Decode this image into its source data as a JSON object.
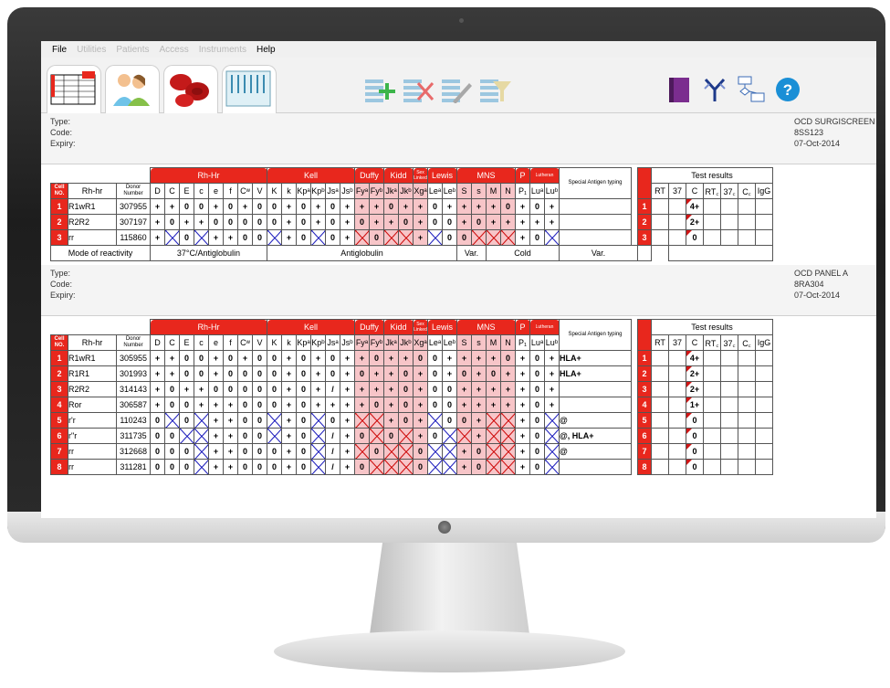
{
  "menu": {
    "file": "File",
    "utilities": "Utilities",
    "patients": "Patients",
    "access": "Access",
    "instruments": "Instruments",
    "help": "Help"
  },
  "icons": {
    "tab1": "panel-grid-icon",
    "tab2": "patients-icon",
    "tab3": "blood-cells-icon",
    "tab4": "cassette-icon",
    "add": "add-row-icon",
    "delete": "delete-row-icon",
    "edit": "edit-icon",
    "filter": "filter-icon",
    "book": "book-icon",
    "antibody": "antibody-icon",
    "workflow": "workflow-icon",
    "help": "help-icon"
  },
  "sections": [
    {
      "info": {
        "type_label": "Type:",
        "code_label": "Code:",
        "expiry_label": "Expiry:",
        "type": "OCD SURGISCREEN",
        "code": "8SS123",
        "expiry": "07-Oct-2014"
      },
      "rows": [
        {
          "no": "1",
          "rh": "R1wR1",
          "donor": "307955",
          "special": "",
          "res": [
            "",
            "",
            "4+",
            "",
            "",
            ""
          ]
        },
        {
          "no": "2",
          "rh": "R2R2",
          "donor": "307197",
          "special": "",
          "res": [
            "",
            "",
            "2+",
            "",
            "",
            ""
          ]
        },
        {
          "no": "3",
          "rh": "rr",
          "donor": "115860",
          "special": "",
          "res": [
            "",
            "",
            "0",
            "",
            "",
            ""
          ]
        }
      ],
      "mode": {
        "label": "Mode of reactivity",
        "rh": "37°C/Antiglobulin",
        "kell": "Antiglobulin",
        "lewis": "Var.",
        "mns": "Cold",
        "luth": "Var."
      }
    },
    {
      "info": {
        "type_label": "Type:",
        "code_label": "Code:",
        "expiry_label": "Expiry:",
        "type": "OCD PANEL A",
        "code": "8RA304",
        "expiry": "07-Oct-2014"
      },
      "rows": [
        {
          "no": "1",
          "rh": "R1wR1",
          "donor": "305955",
          "special": "HLA+",
          "res": [
            "",
            "",
            "4+",
            "",
            "",
            ""
          ]
        },
        {
          "no": "2",
          "rh": "R1R1",
          "donor": "301993",
          "special": "HLA+",
          "res": [
            "",
            "",
            "2+",
            "",
            "",
            ""
          ]
        },
        {
          "no": "3",
          "rh": "R2R2",
          "donor": "314143",
          "special": "",
          "res": [
            "",
            "",
            "2+",
            "",
            "",
            ""
          ]
        },
        {
          "no": "4",
          "rh": "Ror",
          "donor": "306587",
          "special": "",
          "res": [
            "",
            "",
            "1+",
            "",
            "",
            ""
          ]
        },
        {
          "no": "5",
          "rh": "r'r",
          "donor": "110243",
          "special": "@",
          "res": [
            "",
            "",
            "0",
            "",
            "",
            ""
          ]
        },
        {
          "no": "6",
          "rh": "r\"r",
          "donor": "311735",
          "special": "@, HLA+",
          "res": [
            "",
            "",
            "0",
            "",
            "",
            ""
          ]
        },
        {
          "no": "7",
          "rh": "rr",
          "donor": "312668",
          "special": "@",
          "res": [
            "",
            "",
            "0",
            "",
            "",
            ""
          ]
        },
        {
          "no": "8",
          "rh": "rr",
          "donor": "311281",
          "special": "",
          "res": [
            "",
            "",
            "0",
            "",
            "",
            ""
          ]
        }
      ]
    }
  ],
  "headers": {
    "cell_no": "Cell NO.",
    "rh_hr": "Rh-hr",
    "donor": "Donor Number",
    "groups": {
      "rh": "Rh-Hr",
      "kell": "Kell",
      "duffy": "Duffy",
      "kidd": "Kidd",
      "sex": "Sex Linked",
      "lewis": "Lewis",
      "mns": "MNS",
      "p": "P",
      "luth": "Lutheran"
    },
    "special": "Special Antigen typing",
    "test": "Test results",
    "ant": [
      "D",
      "C",
      "E",
      "c",
      "e",
      "f",
      "Cʷ",
      "V",
      "K",
      "k",
      "Kpᵃ",
      "Kpᵇ",
      "Jsᵃ",
      "Jsᵇ",
      "Fyᵃ",
      "Fyᵇ",
      "Jkᵃ",
      "Jkᵇ",
      "Xgᵃ",
      "Leᵃ",
      "Leᵇ",
      "S",
      "s",
      "M",
      "N",
      "P₁",
      "Luᵃ",
      "Luᵇ"
    ],
    "tcols": [
      "RT",
      "37",
      "C",
      "RT꜀",
      "37꜀",
      "C꜀",
      "IgG"
    ]
  },
  "grid1": [
    [
      "+",
      "+",
      "0",
      "0",
      "+",
      "0",
      "+",
      "0",
      "0",
      "+",
      "0",
      "+",
      "0",
      "+",
      "+",
      "+",
      "0",
      "+",
      "+",
      "0",
      "+",
      "+",
      "+",
      "+",
      "0",
      "+",
      "0",
      "+"
    ],
    [
      "+",
      "0",
      "+",
      "+",
      "0",
      "0",
      "0",
      "0",
      "0",
      "+",
      "0",
      "+",
      "0",
      "+",
      "0",
      "+",
      "+",
      "0",
      "+",
      "0",
      "0",
      "+",
      "0",
      "+",
      "+",
      "+",
      "+",
      "+"
    ],
    [
      "+",
      "X",
      "0",
      "X",
      "+",
      "+",
      "0",
      "0",
      "X",
      "+",
      "0",
      "X",
      "0",
      "+",
      "X",
      "0",
      "X",
      "X",
      "+",
      "X",
      "0",
      "0",
      "X",
      "X",
      "X",
      "+",
      "0",
      "X"
    ]
  ],
  "grid2": [
    [
      "+",
      "+",
      "0",
      "0",
      "+",
      "0",
      "+",
      "0",
      "0",
      "+",
      "0",
      "+",
      "0",
      "+",
      "+",
      "0",
      "+",
      "+",
      "0",
      "0",
      "+",
      "+",
      "+",
      "+",
      "0",
      "+",
      "0",
      "+"
    ],
    [
      "+",
      "+",
      "0",
      "0",
      "+",
      "0",
      "0",
      "0",
      "0",
      "+",
      "0",
      "+",
      "0",
      "+",
      "0",
      "+",
      "+",
      "0",
      "+",
      "0",
      "+",
      "0",
      "+",
      "0",
      "+",
      "+",
      "0",
      "+"
    ],
    [
      "+",
      "0",
      "+",
      "+",
      "0",
      "0",
      "0",
      "0",
      "0",
      "+",
      "0",
      "+",
      "/",
      "+",
      "+",
      "+",
      "+",
      "0",
      "+",
      "0",
      "0",
      "+",
      "+",
      "+",
      "+",
      "+",
      "0",
      "+"
    ],
    [
      "+",
      "0",
      "0",
      "+",
      "+",
      "+",
      "0",
      "0",
      "0",
      "+",
      "0",
      "+",
      "+",
      "+",
      "+",
      "0",
      "+",
      "0",
      "+",
      "0",
      "0",
      "+",
      "+",
      "+",
      "+",
      "+",
      "0",
      "+"
    ],
    [
      "0",
      "X",
      "0",
      "X",
      "+",
      "+",
      "0",
      "0",
      "X",
      "+",
      "0",
      "X",
      "0",
      "+",
      "X",
      "X",
      "+",
      "0",
      "+",
      "X",
      "0",
      "0",
      "+",
      "X",
      "X",
      "+",
      "0",
      "X"
    ],
    [
      "0",
      "0",
      "X",
      "X",
      "+",
      "+",
      "0",
      "0",
      "X",
      "+",
      "0",
      "X",
      "/",
      "+",
      "0",
      "X",
      "0",
      "X",
      "+",
      "0",
      "X",
      "X",
      "+",
      "X",
      "X",
      "+",
      "0",
      "X"
    ],
    [
      "0",
      "0",
      "0",
      "X",
      "+",
      "+",
      "0",
      "0",
      "0",
      "+",
      "0",
      "X",
      "/",
      "+",
      "X",
      "0",
      "X",
      "X",
      "0",
      "X",
      "X",
      "+",
      "0",
      "X",
      "X",
      "+",
      "0",
      "X"
    ],
    [
      "0",
      "0",
      "0",
      "X",
      "+",
      "+",
      "0",
      "0",
      "0",
      "+",
      "0",
      "X",
      "/",
      "+",
      "0",
      "X",
      "X",
      "X",
      "0",
      "X",
      "X",
      "+",
      "0",
      "X",
      "X",
      "+",
      "0",
      "X"
    ]
  ],
  "colors": {
    "accent": "#e8271d",
    "pink": "#f7c5c8",
    "cross_blue": "#2a2ac0",
    "cross_red": "#d01515"
  }
}
